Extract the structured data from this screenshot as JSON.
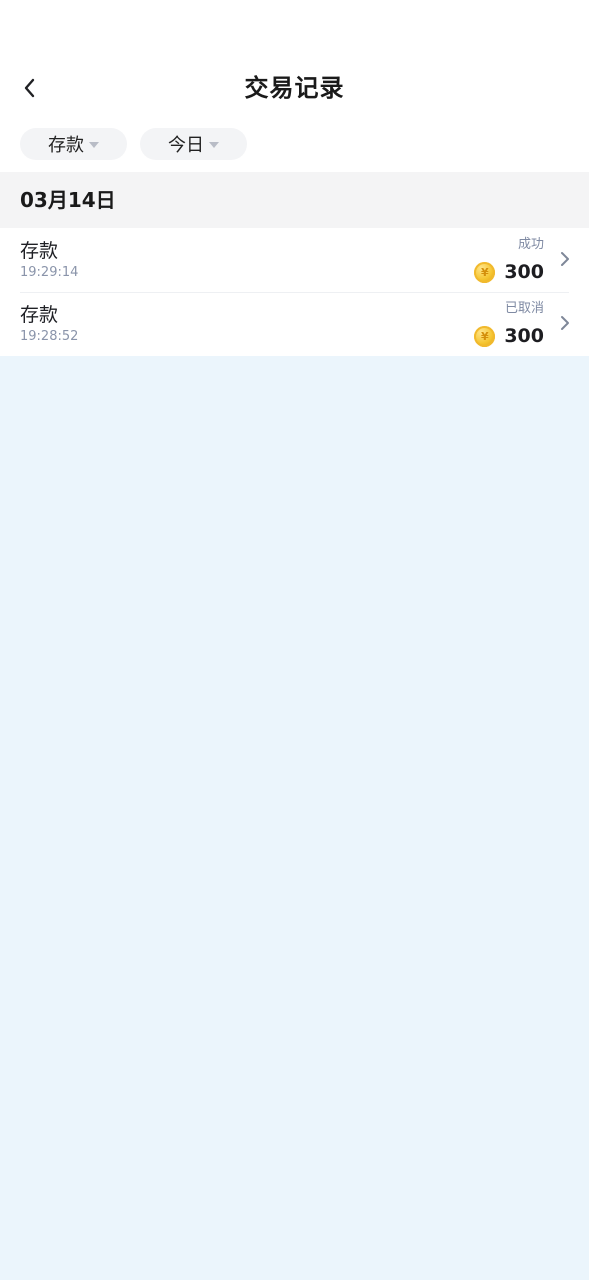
{
  "header": {
    "title": "交易记录",
    "back_icon": "chevron-left-icon"
  },
  "filters": {
    "type": {
      "label": "存款",
      "icon": "caret-down-icon"
    },
    "date": {
      "label": "今日",
      "icon": "caret-down-icon"
    }
  },
  "section": {
    "date_label": "03月14日"
  },
  "transactions": [
    {
      "title": "存款",
      "time": "19:29:14",
      "status": "成功",
      "amount": "300",
      "icon": "coin-icon"
    },
    {
      "title": "存款",
      "time": "19:28:52",
      "status": "已取消",
      "amount": "300",
      "icon": "coin-icon"
    }
  ],
  "colors": {
    "page_background": "#ebf5fc",
    "section_background": "#f4f4f5",
    "chip_background": "#f3f4f6",
    "status_text": "#7f8aa3",
    "coin_gold": "#f5c531"
  }
}
